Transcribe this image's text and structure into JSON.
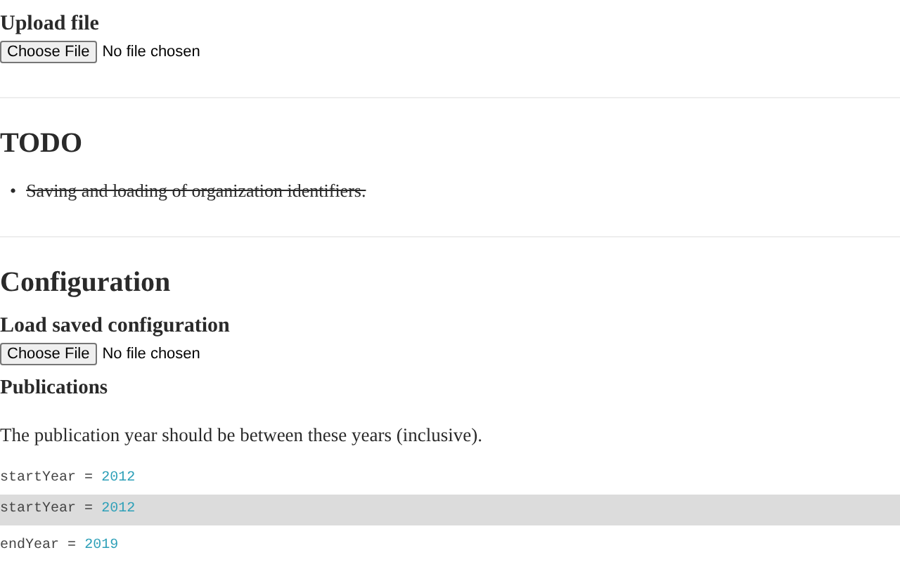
{
  "upload": {
    "title": "Upload file",
    "button": "Choose File",
    "status": "No file chosen"
  },
  "todo": {
    "title": "TODO",
    "items": [
      {
        "marker": "•",
        "text": "Saving and loading of organization identifiers.",
        "done": true
      }
    ]
  },
  "configuration": {
    "title": "Configuration",
    "load": {
      "title": "Load saved configuration",
      "button": "Choose File",
      "status": "No file chosen"
    },
    "publications": {
      "title": "Publications",
      "description": "The publication year should be between these years (inclusive).",
      "lines": [
        {
          "name": "startYear",
          "operator": "=",
          "value": "2012",
          "highlighted": false
        },
        {
          "name": "startYear",
          "operator": "=",
          "value": "2012",
          "highlighted": true
        },
        {
          "name": "endYear",
          "operator": "=",
          "value": "2019",
          "highlighted": false
        }
      ]
    }
  }
}
